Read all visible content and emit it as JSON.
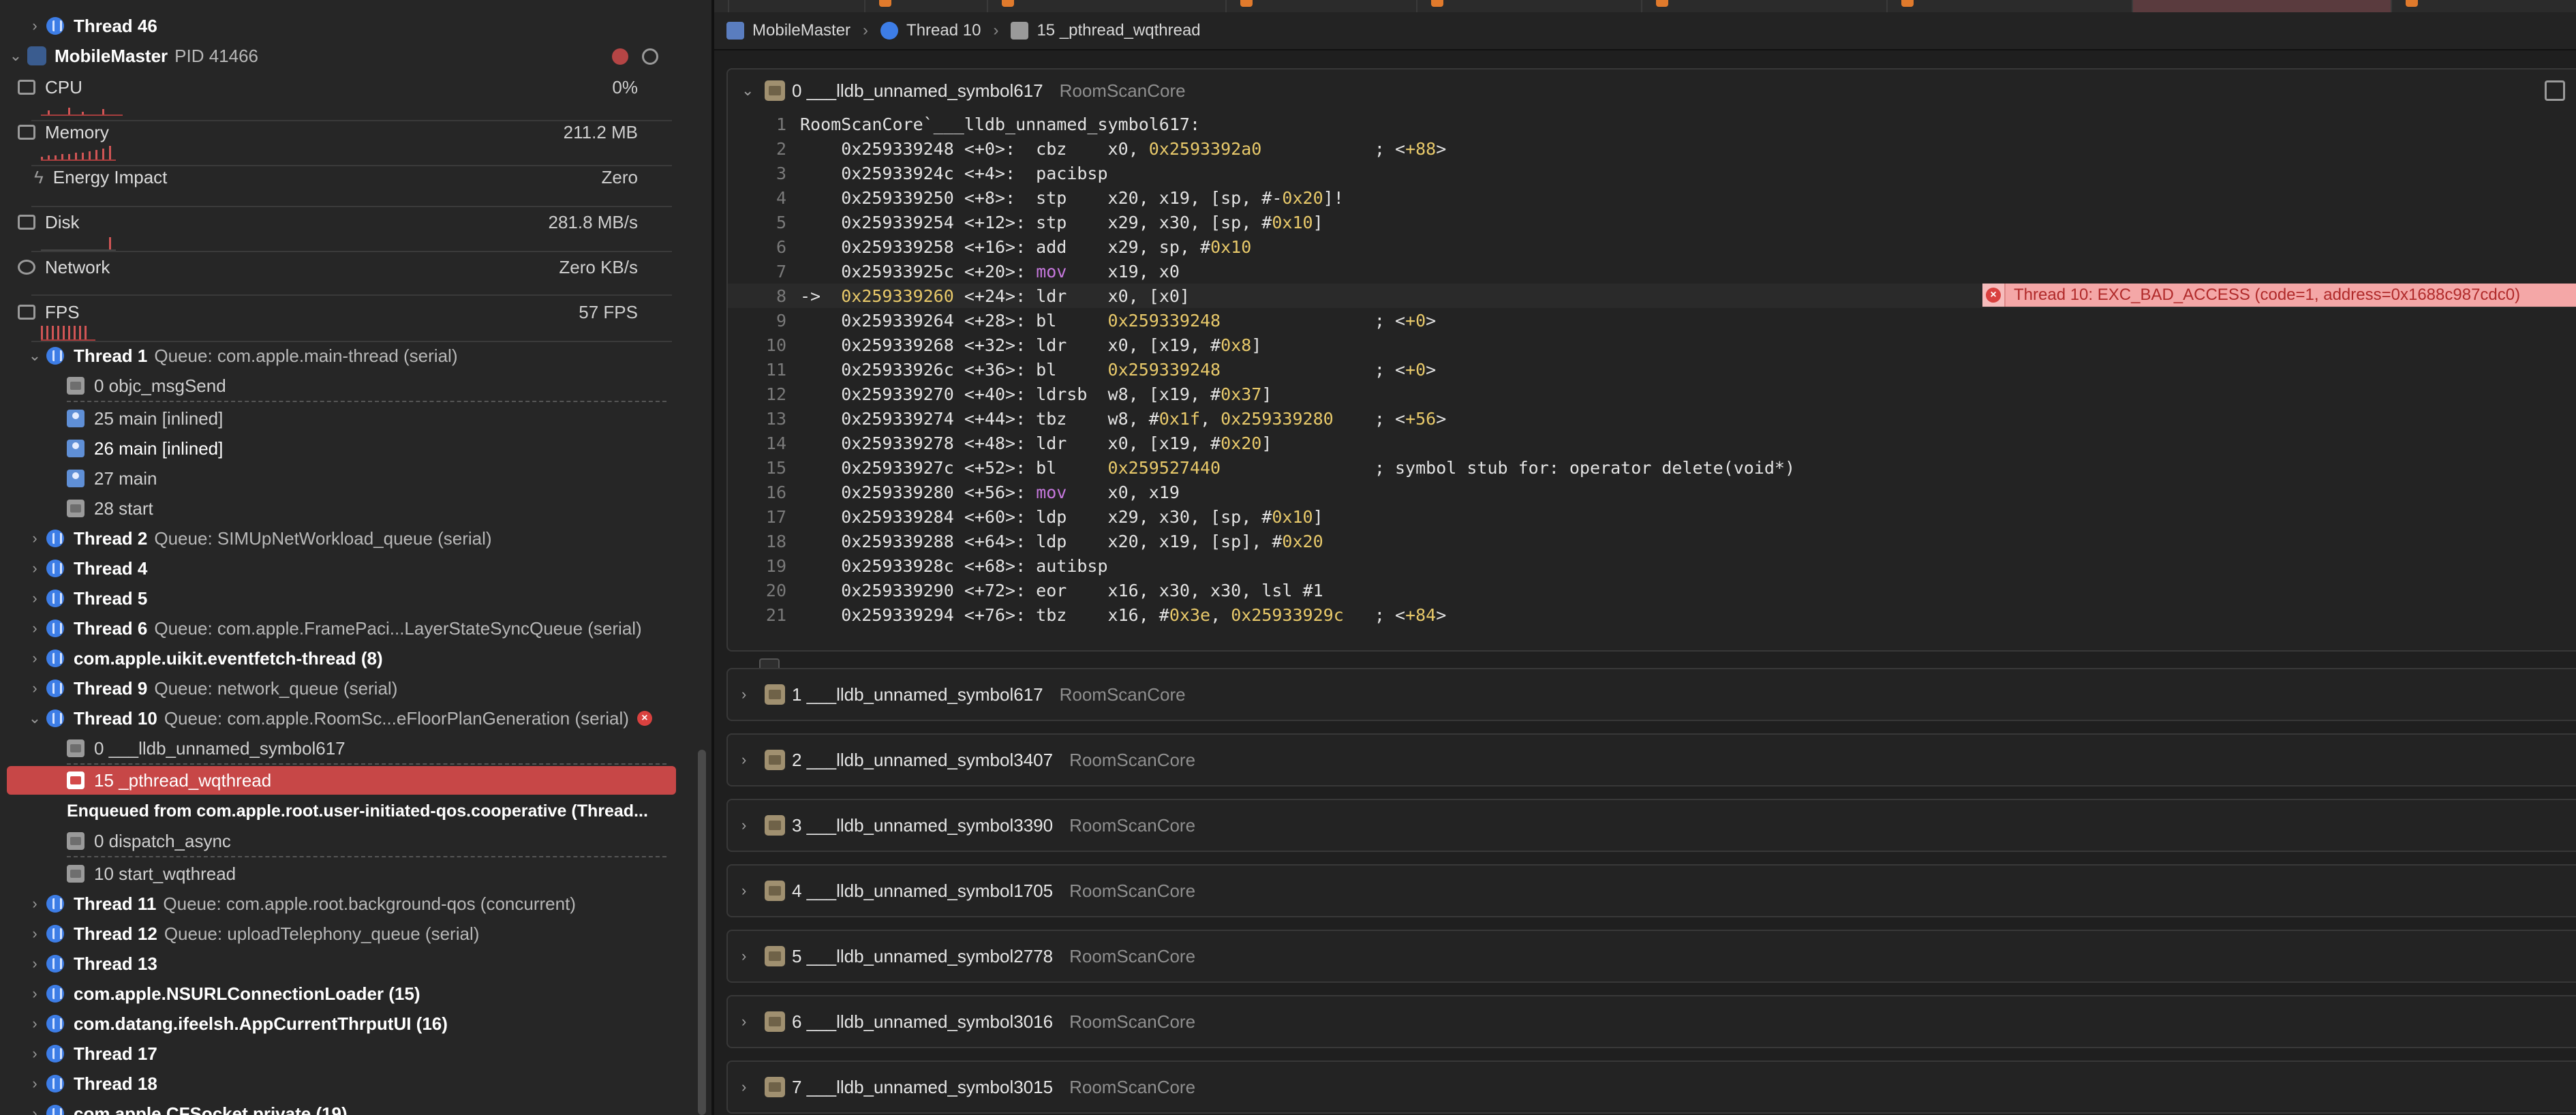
{
  "navigator": {
    "top_thread": "Thread 46",
    "process": {
      "name": "MobileMaster",
      "pid": "PID 41466"
    },
    "gauges": [
      {
        "label": "CPU",
        "value": "0%",
        "icon": "cpu-icon"
      },
      {
        "label": "Memory",
        "value": "211.2 MB",
        "icon": "memory-icon"
      },
      {
        "label": "Energy Impact",
        "value": "Zero",
        "icon": "energy-icon"
      },
      {
        "label": "Disk",
        "value": "281.8 MB/s",
        "icon": "disk-icon"
      },
      {
        "label": "Network",
        "value": "Zero KB/s",
        "icon": "network-icon"
      },
      {
        "label": "FPS",
        "value": "57 FPS",
        "icon": "fps-icon"
      }
    ],
    "thread1": {
      "name": "Thread 1",
      "queue": "Queue: com.apple.main-thread (serial)"
    },
    "thread1_frames": [
      "0 objc_msgSend",
      "25 main [inlined]",
      "26 main [inlined]",
      "27 main",
      "28 start"
    ],
    "threads_a": [
      {
        "name": "Thread 2",
        "queue": "Queue: SIMUpNetWorkload_queue (serial)"
      },
      {
        "name": "Thread 4",
        "queue": ""
      },
      {
        "name": "Thread 5",
        "queue": ""
      },
      {
        "name": "Thread 6",
        "queue": "Queue: com.apple.FramePaci...LayerStateSyncQueue (serial)"
      },
      {
        "name": "com.apple.uikit.eventfetch-thread (8)",
        "queue": ""
      },
      {
        "name": "Thread 9",
        "queue": "Queue: network_queue (serial)"
      }
    ],
    "thread10": {
      "name": "Thread 10",
      "queue": "Queue: com.apple.RoomSc...eFloorPlanGeneration (serial)",
      "badge": "×"
    },
    "thread10_frames": [
      "0 ___lldb_unnamed_symbol617",
      "15 _pthread_wqthread"
    ],
    "enqueued": "Enqueued from com.apple.root.user-initiated-qos.cooperative (Thread...",
    "enqueued_frames": [
      "0 dispatch_async",
      "10 start_wqthread"
    ],
    "threads_b": [
      {
        "name": "Thread 11",
        "queue": "Queue: com.apple.root.background-qos (concurrent)"
      },
      {
        "name": "Thread 12",
        "queue": "Queue: uploadTelephony_queue (serial)"
      },
      {
        "name": "Thread 13",
        "queue": ""
      },
      {
        "name": "com.apple.NSURLConnectionLoader (15)",
        "queue": ""
      },
      {
        "name": "com.datang.ifeelsh.AppCurrentThrputUI (16)",
        "queue": ""
      },
      {
        "name": "Thread 17",
        "queue": ""
      },
      {
        "name": "Thread 18",
        "queue": ""
      },
      {
        "name": "com.apple.CFSocket.private (19)",
        "queue": ""
      }
    ]
  },
  "jumpbar": {
    "project": "MobileMaster",
    "thread": "Thread 10",
    "frame": "15 _pthread_wqthread"
  },
  "expanded_frame": {
    "title": "0 ___lldb_unnamed_symbol617",
    "module": "RoomScanCore",
    "lines": [
      {
        "n": "1",
        "t": "RoomScanCore`___lldb_unnamed_symbol617:"
      },
      {
        "n": "2",
        "t": "    0x259339248 <+0>:  cbz    x0, 0x2593392a0           ; <+88>"
      },
      {
        "n": "3",
        "t": "    0x25933924c <+4>:  pacibsp"
      },
      {
        "n": "4",
        "t": "    0x259339250 <+8>:  stp    x20, x19, [sp, #-0x20]!"
      },
      {
        "n": "5",
        "t": "    0x259339254 <+12>: stp    x29, x30, [sp, #0x10]"
      },
      {
        "n": "6",
        "t": "    0x259339258 <+16>: add    x29, sp, #0x10"
      },
      {
        "n": "7",
        "t": "    0x25933925c <+20>: mov    x19, x0"
      },
      {
        "n": "8",
        "t": "->  0x259339260 <+24>: ldr    x0, [x0]"
      },
      {
        "n": "9",
        "t": "    0x259339264 <+28>: bl     0x259339248               ; <+0>"
      },
      {
        "n": "10",
        "t": "    0x259339268 <+32>: ldr    x0, [x19, #0x8]"
      },
      {
        "n": "11",
        "t": "    0x25933926c <+36>: bl     0x259339248               ; <+0>"
      },
      {
        "n": "12",
        "t": "    0x259339270 <+40>: ldrsb  w8, [x19, #0x37]"
      },
      {
        "n": "13",
        "t": "    0x259339274 <+44>: tbz    w8, #0x1f, 0x259339280    ; <+56>"
      },
      {
        "n": "14",
        "t": "    0x259339278 <+48>: ldr    x0, [x19, #0x20]"
      },
      {
        "n": "15",
        "t": "    0x25933927c <+52>: bl     0x259527440               ; symbol stub for: operator delete(void*)"
      },
      {
        "n": "16",
        "t": "    0x259339280 <+56>: mov    x0, x19"
      },
      {
        "n": "17",
        "t": "    0x259339284 <+60>: ldp    x29, x30, [sp, #0x10]"
      },
      {
        "n": "18",
        "t": "    0x259339288 <+64>: ldp    x20, x19, [sp], #0x20"
      },
      {
        "n": "19",
        "t": "    0x25933928c <+68>: autibsp"
      },
      {
        "n": "20",
        "t": "    0x259339290 <+72>: eor    x16, x30, x30, lsl #1"
      },
      {
        "n": "21",
        "t": "    0x259339294 <+76>: tbz    x16, #0x3e, 0x25933929c   ; <+84>"
      }
    ],
    "crash_message": "Thread 10: EXC_BAD_ACCESS (code=1, address=0x1688c987cdc0)"
  },
  "collapsed_frames": [
    {
      "title": "1 ___lldb_unnamed_symbol617",
      "module": "RoomScanCore"
    },
    {
      "title": "2 ___lldb_unnamed_symbol3407",
      "module": "RoomScanCore"
    },
    {
      "title": "3 ___lldb_unnamed_symbol3390",
      "module": "RoomScanCore"
    },
    {
      "title": "4 ___lldb_unnamed_symbol1705",
      "module": "RoomScanCore"
    },
    {
      "title": "5 ___lldb_unnamed_symbol2778",
      "module": "RoomScanCore"
    },
    {
      "title": "6 ___lldb_unnamed_symbol3016",
      "module": "RoomScanCore"
    },
    {
      "title": "7 ___lldb_unnamed_symbol3015",
      "module": "RoomScanCore"
    }
  ],
  "colors": {
    "selection": "#c74747",
    "crash_banner": "#f4a7a7",
    "thread_icon": "#3d7de6",
    "hex": "#e8c96a",
    "keyword": "#c678dd"
  }
}
